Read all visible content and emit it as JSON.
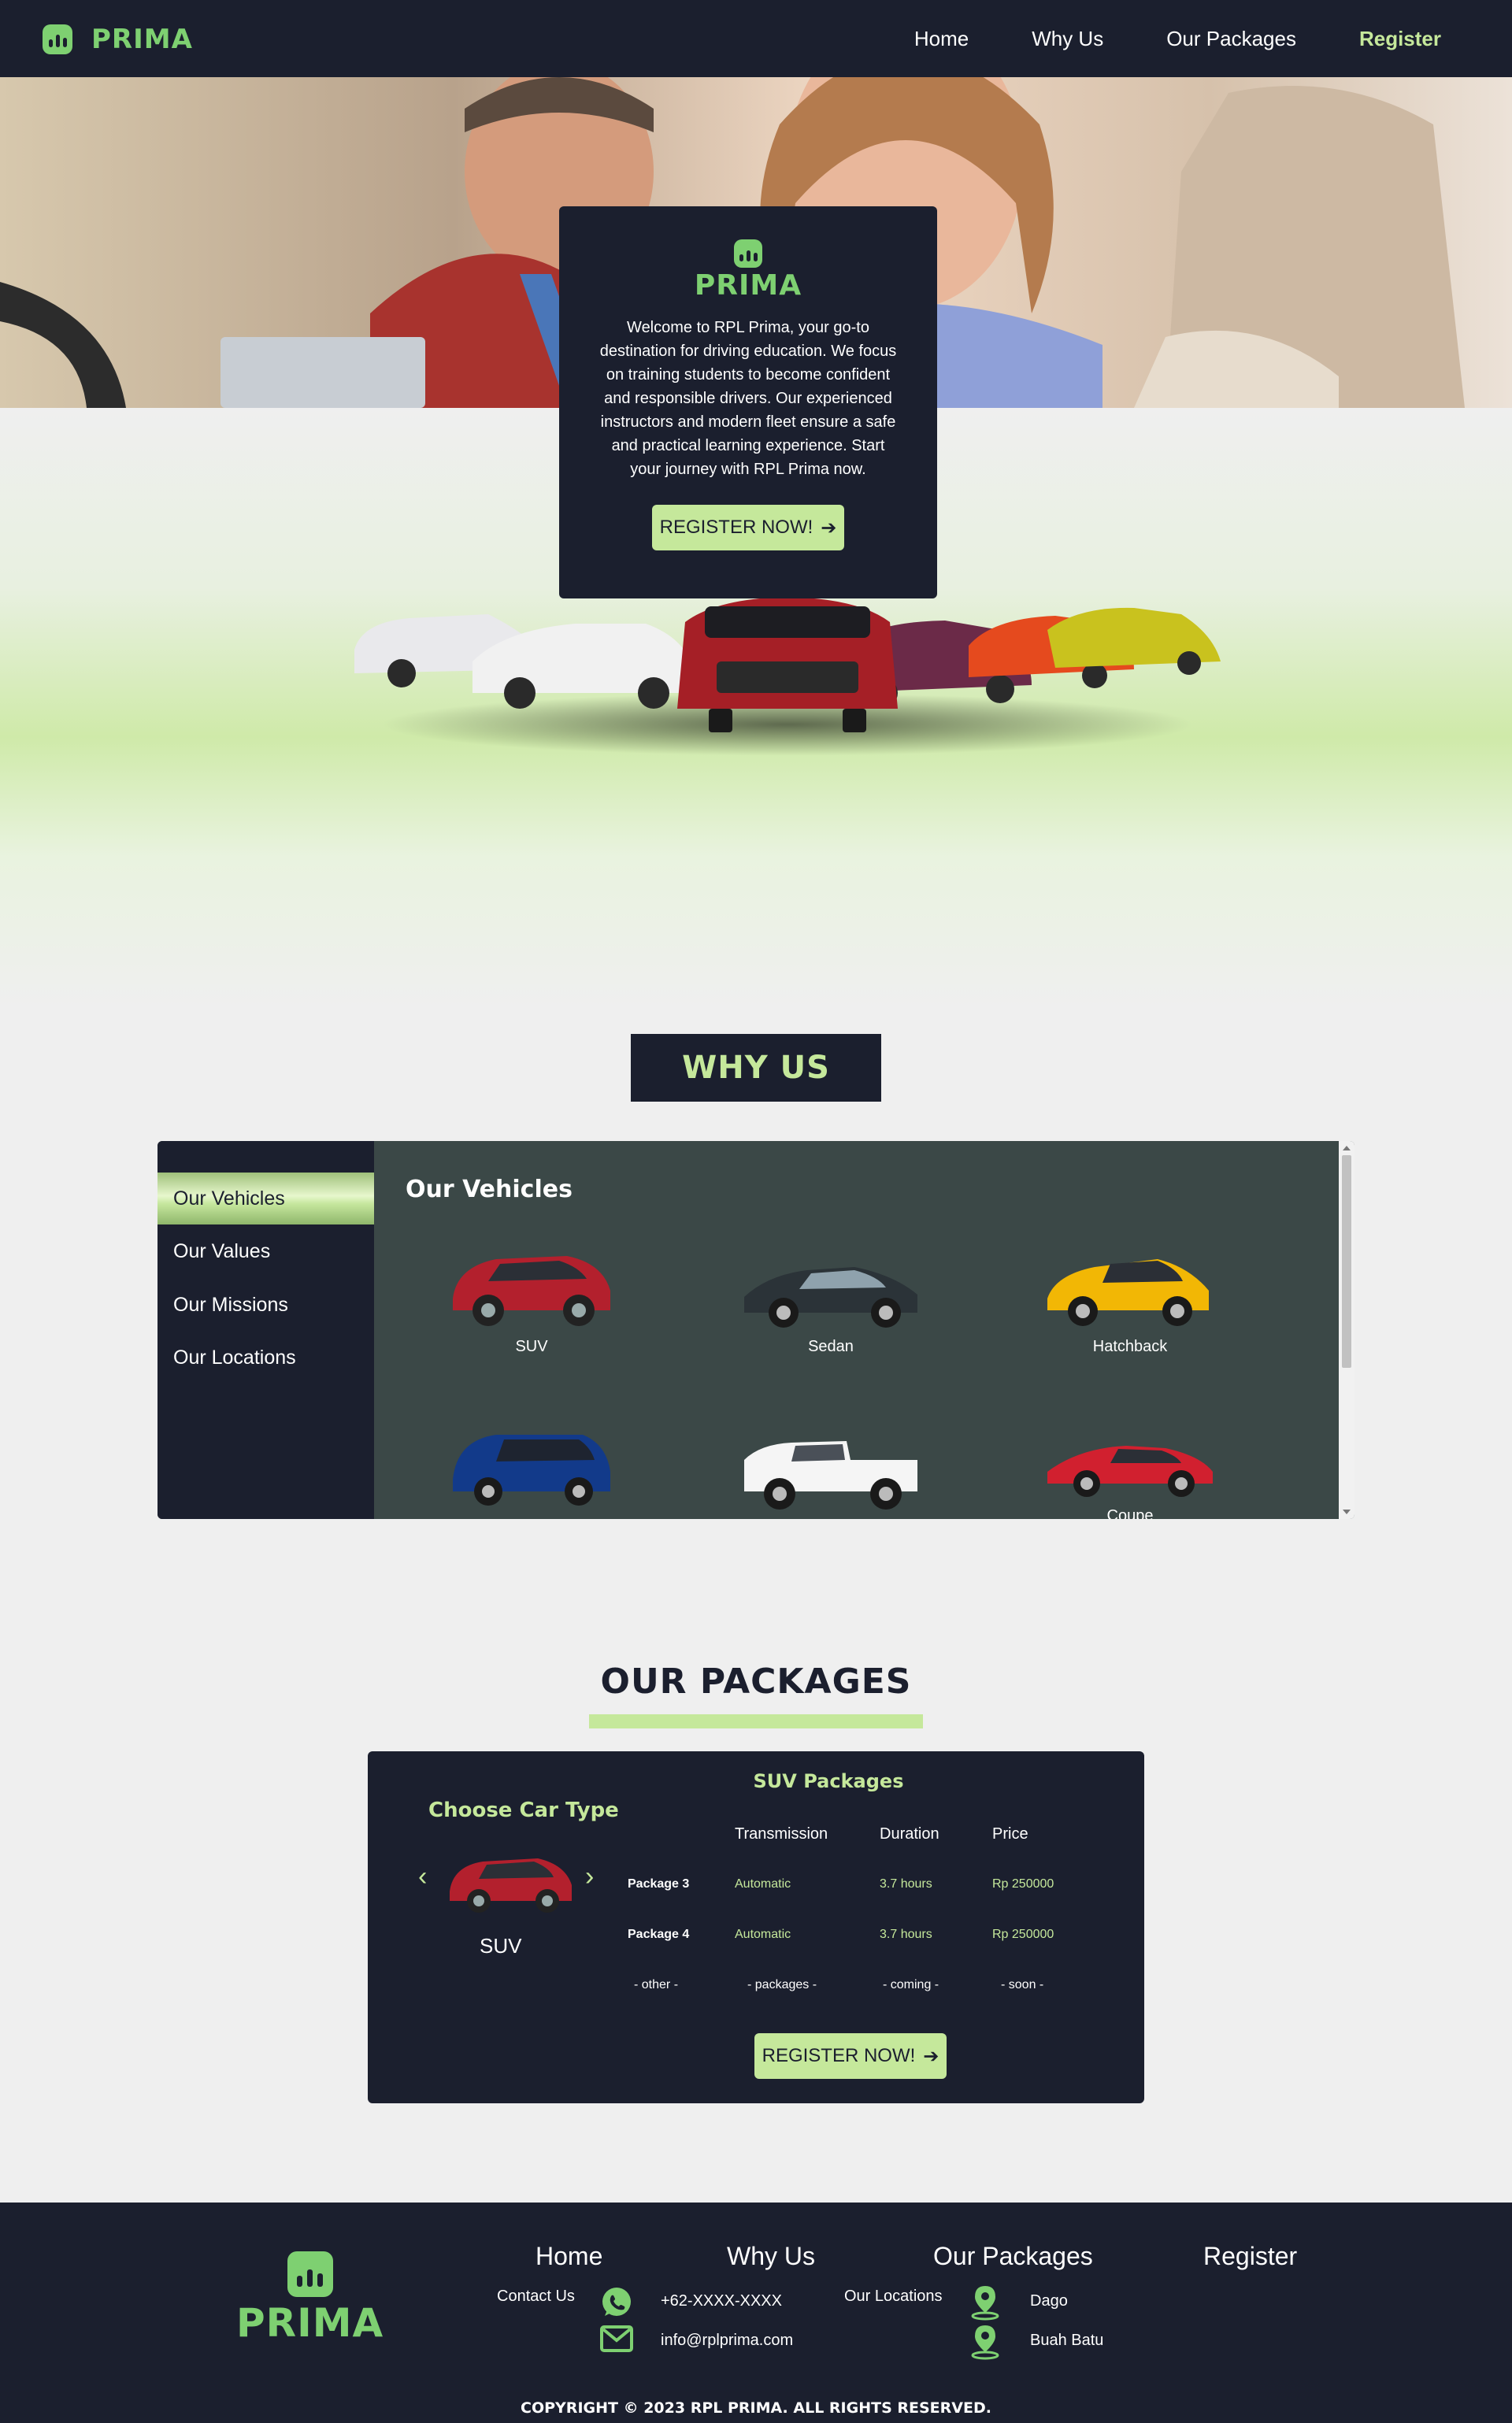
{
  "brand": {
    "name": "PRIMA"
  },
  "nav": {
    "items": [
      "Home",
      "Why Us",
      "Our Packages",
      "Register"
    ]
  },
  "hero": {
    "welcome": "Welcome to RPL Prima, your go-to destination for driving education. We focus on training students to become confident and responsible drivers. Our experienced instructors and modern fleet ensure a safe and practical learning experience. Start your journey with RPL Prima now.",
    "cta": "REGISTER NOW!",
    "cta_icon": "arrow-right-icon"
  },
  "why_us": {
    "title": "WHY US",
    "tabs": [
      "Our Vehicles",
      "Our Values",
      "Our Missions",
      "Our Locations"
    ],
    "active_tab": "Our Vehicles",
    "content_title": "Our Vehicles",
    "vehicles": [
      {
        "label": "SUV",
        "color": "#b3202d"
      },
      {
        "label": "Sedan",
        "color": "#2b3338"
      },
      {
        "label": "Hatchback",
        "color": "#f2b705"
      },
      {
        "label": "",
        "color": "#123a8a"
      },
      {
        "label": "",
        "color": "#f5f5f5"
      },
      {
        "label": "Coupe",
        "color": "#d1202f"
      }
    ]
  },
  "packages": {
    "title": "OUR PACKAGES",
    "choose_label": "Choose Car Type",
    "selected_car": "SUV",
    "heading": "SUV Packages",
    "columns": [
      "Transmission",
      "Duration",
      "Price"
    ],
    "rows": [
      {
        "name": "Package 3",
        "transmission": "Automatic",
        "duration": "3.7 hours",
        "price": "Rp 250000"
      },
      {
        "name": "Package 4",
        "transmission": "Automatic",
        "duration": "3.7 hours",
        "price": "Rp 250000"
      }
    ],
    "footer_row": [
      "- other -",
      "- packages -",
      "- coming -",
      "- soon -"
    ],
    "cta": "REGISTER NOW!"
  },
  "footer": {
    "nav": [
      "Home",
      "Why Us",
      "Our Packages",
      "Register"
    ],
    "contact_label": "Contact Us",
    "phone": "+62-XXXX-XXXX",
    "email": "info@rplprima.com",
    "locations_label": "Our Locations",
    "locations": [
      "Dago",
      "Buah Batu"
    ],
    "copyright": "COPYRIGHT © 2023 RPL PRIMA. ALL RIGHTS RESERVED."
  },
  "colors": {
    "navy": "#1b1f2e",
    "accent": "#c5e89b",
    "logo_green": "#7ed071",
    "panel": "#3b4847"
  }
}
